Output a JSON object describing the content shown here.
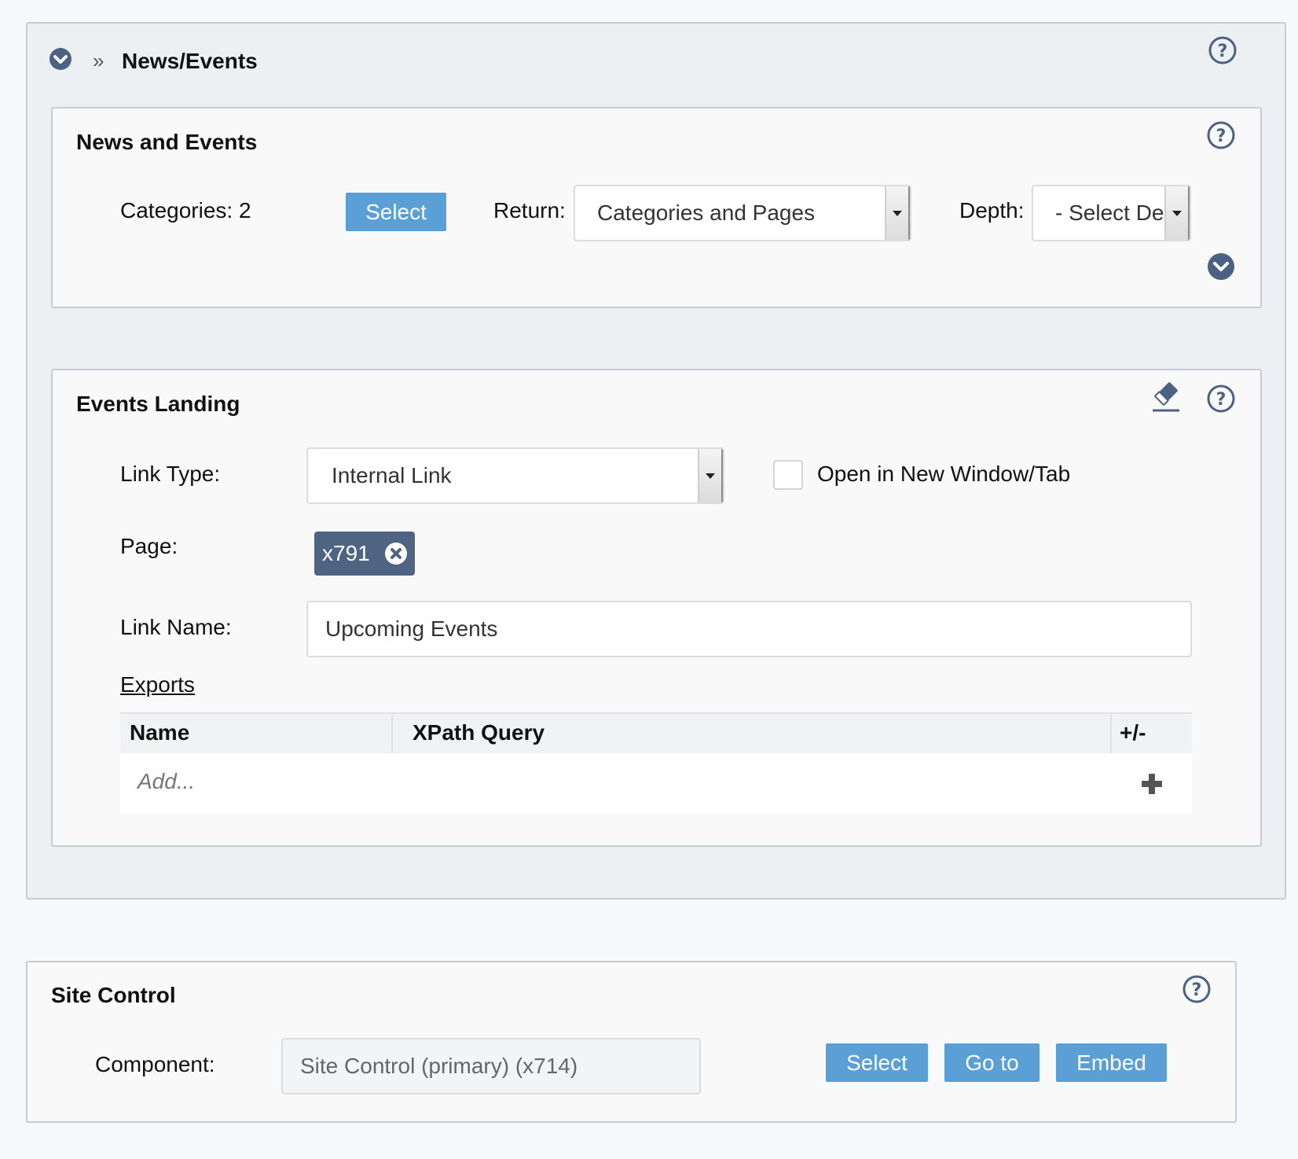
{
  "section": {
    "breadcrumb_sep": "»",
    "title": "News/Events"
  },
  "news_events": {
    "title": "News and Events",
    "categories_label": "Categories: 2",
    "select_button": "Select",
    "return_label": "Return:",
    "return_value": "Categories and Pages",
    "depth_label": "Depth:",
    "depth_value": "- Select Dep"
  },
  "events_landing": {
    "title": "Events Landing",
    "link_type_label": "Link Type:",
    "link_type_value": "Internal Link",
    "open_new_window_label": "Open in New Window/Tab",
    "open_new_window_checked": false,
    "page_label": "Page:",
    "page_tag": "x791",
    "link_name_label": "Link Name:",
    "link_name_value": "Upcoming Events",
    "exports_link": "Exports",
    "table": {
      "headers": [
        "Name",
        "XPath Query",
        "+/-"
      ],
      "add_placeholder": "Add..."
    }
  },
  "site_control": {
    "title": "Site Control",
    "component_label": "Component:",
    "component_value": "Site Control (primary) (x714)",
    "buttons": [
      "Select",
      "Go to",
      "Embed"
    ]
  },
  "colors": {
    "accent": "#5a9fd6",
    "icon": "#4b6283",
    "tag": "#4f6382"
  }
}
